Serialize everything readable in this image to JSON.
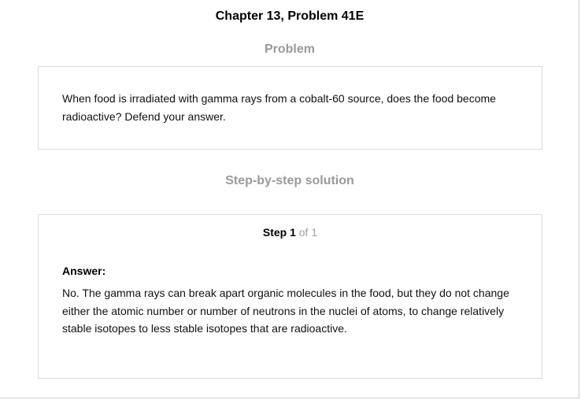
{
  "header": {
    "title": "Chapter 13, Problem 41E"
  },
  "problem": {
    "heading": "Problem",
    "text": "When food is irradiated with gamma rays from a cobalt-60 source, does the food become radioactive? Defend your answer."
  },
  "solution": {
    "heading": "Step-by-step solution",
    "step": {
      "label": "Step 1",
      "of_text": "of 1"
    },
    "answer_label": "Answer:",
    "answer_text": "No. The gamma rays can break apart organic molecules in the food, but they do not change either the atomic number or number of neutrons in the nuclei of atoms, to change relatively stable isotopes to less stable isotopes that are radioactive."
  }
}
